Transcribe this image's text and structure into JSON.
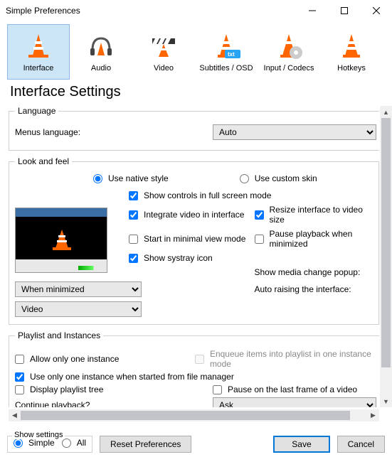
{
  "window": {
    "title": "Simple Preferences"
  },
  "tabs": [
    {
      "id": "interface",
      "label": "Interface",
      "selected": true
    },
    {
      "id": "audio",
      "label": "Audio"
    },
    {
      "id": "video",
      "label": "Video"
    },
    {
      "id": "subtitles",
      "label": "Subtitles / OSD"
    },
    {
      "id": "input",
      "label": "Input / Codecs"
    },
    {
      "id": "hotkeys",
      "label": "Hotkeys"
    }
  ],
  "section_title": "Interface Settings",
  "language": {
    "legend": "Language",
    "menus_label": "Menus language:",
    "value": "Auto"
  },
  "look": {
    "legend": "Look and feel",
    "native_label": "Use native style",
    "custom_label": "Use custom skin",
    "style_selected": "native",
    "show_controls": {
      "label": "Show controls in full screen mode",
      "checked": true
    },
    "integrate_video": {
      "label": "Integrate video in interface",
      "checked": true
    },
    "resize_interface": {
      "label": "Resize interface to video size",
      "checked": true
    },
    "start_minimal": {
      "label": "Start in minimal view mode",
      "checked": false
    },
    "pause_minimized": {
      "label": "Pause playback when minimized",
      "checked": false
    },
    "systray": {
      "label": "Show systray icon",
      "checked": true
    },
    "media_popup_label": "Show media change popup:",
    "media_popup_value": "When minimized",
    "auto_raise_label": "Auto raising the interface:",
    "auto_raise_value": "Video"
  },
  "playlist": {
    "legend": "Playlist and Instances",
    "one_instance": {
      "label": "Allow only one instance",
      "checked": false
    },
    "enqueue": {
      "label": "Enqueue items into playlist in one instance mode",
      "checked": false,
      "disabled": true
    },
    "one_instance_fm": {
      "label": "Use only one instance when started from file manager",
      "checked": true
    },
    "display_tree": {
      "label": "Display playlist tree",
      "checked": false
    },
    "pause_last_frame": {
      "label": "Pause on the last frame of a video",
      "checked": false
    },
    "continue_label": "Continue playback?",
    "continue_value": "Ask"
  },
  "footer": {
    "show_settings_legend": "Show settings",
    "simple_label": "Simple",
    "all_label": "All",
    "selected": "simple",
    "reset_label": "Reset Preferences",
    "save_label": "Save",
    "cancel_label": "Cancel"
  }
}
